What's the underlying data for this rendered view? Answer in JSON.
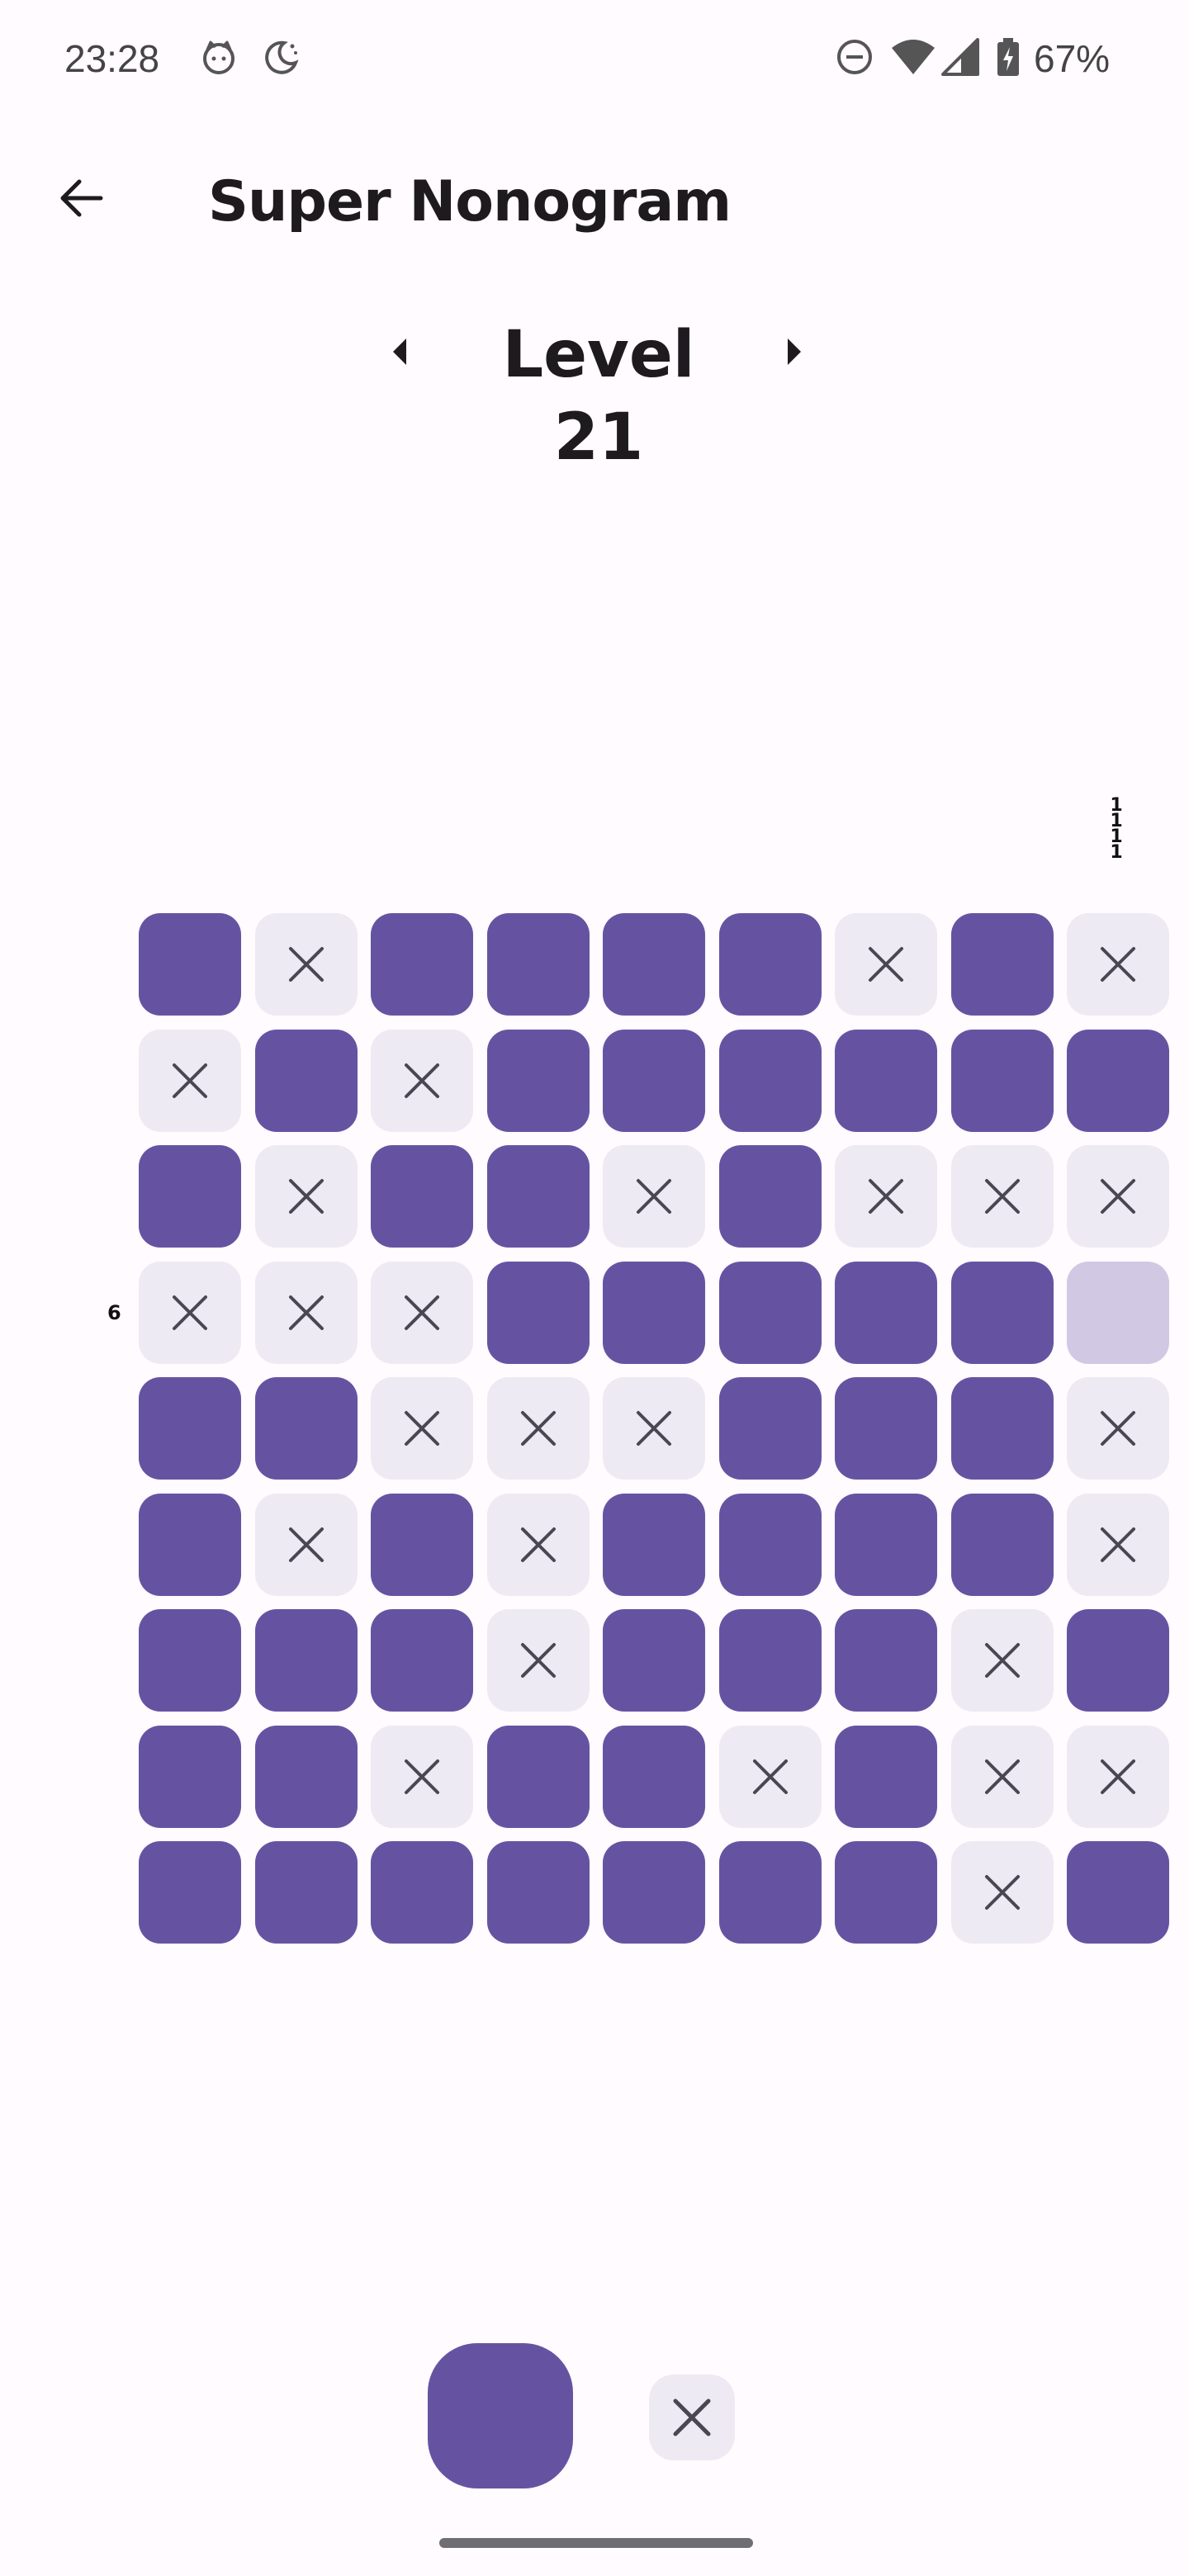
{
  "status_bar": {
    "time": "23:28",
    "battery": "67%",
    "icons": [
      "cat-notification-icon",
      "do-not-disturb-moon-icon",
      "dnd-minus-icon",
      "wifi-icon",
      "cell-signal-icon",
      "battery-charging-icon"
    ]
  },
  "app_bar": {
    "title": "Super Nonogram",
    "back_icon": "arrow-left-icon"
  },
  "level": {
    "label": "Level 21",
    "prev_icon": "caret-left-icon",
    "next_icon": "caret-right-icon"
  },
  "clues": {
    "column_highlighted": [
      "1",
      "1",
      "1",
      "1"
    ],
    "row_highlighted": "6"
  },
  "board": {
    "size": 9,
    "legend": "F = filled, X = crossed, S = selected (empty, highlighted)",
    "rows": [
      [
        "F",
        "X",
        "F",
        "F",
        "F",
        "F",
        "X",
        "F",
        "X"
      ],
      [
        "X",
        "F",
        "X",
        "F",
        "F",
        "F",
        "F",
        "F",
        "F"
      ],
      [
        "F",
        "X",
        "F",
        "F",
        "X",
        "F",
        "X",
        "X",
        "X"
      ],
      [
        "X",
        "X",
        "X",
        "F",
        "F",
        "F",
        "F",
        "F",
        "S"
      ],
      [
        "F",
        "F",
        "X",
        "X",
        "X",
        "F",
        "F",
        "F",
        "X"
      ],
      [
        "F",
        "X",
        "F",
        "X",
        "F",
        "F",
        "F",
        "F",
        "X"
      ],
      [
        "F",
        "F",
        "F",
        "X",
        "F",
        "F",
        "F",
        "X",
        "F"
      ],
      [
        "F",
        "F",
        "X",
        "F",
        "F",
        "X",
        "F",
        "X",
        "X"
      ],
      [
        "F",
        "F",
        "F",
        "F",
        "F",
        "F",
        "F",
        "X",
        "F"
      ]
    ]
  },
  "tools": {
    "fill_icon": "filled-square-tool-icon",
    "cross_icon": "cross-tool-icon"
  },
  "colors": {
    "filled": "#6553a2",
    "empty": "#eeeaf3",
    "selected": "#d1c8e4",
    "cross": "#4a4752",
    "background": "#fffbfe"
  }
}
